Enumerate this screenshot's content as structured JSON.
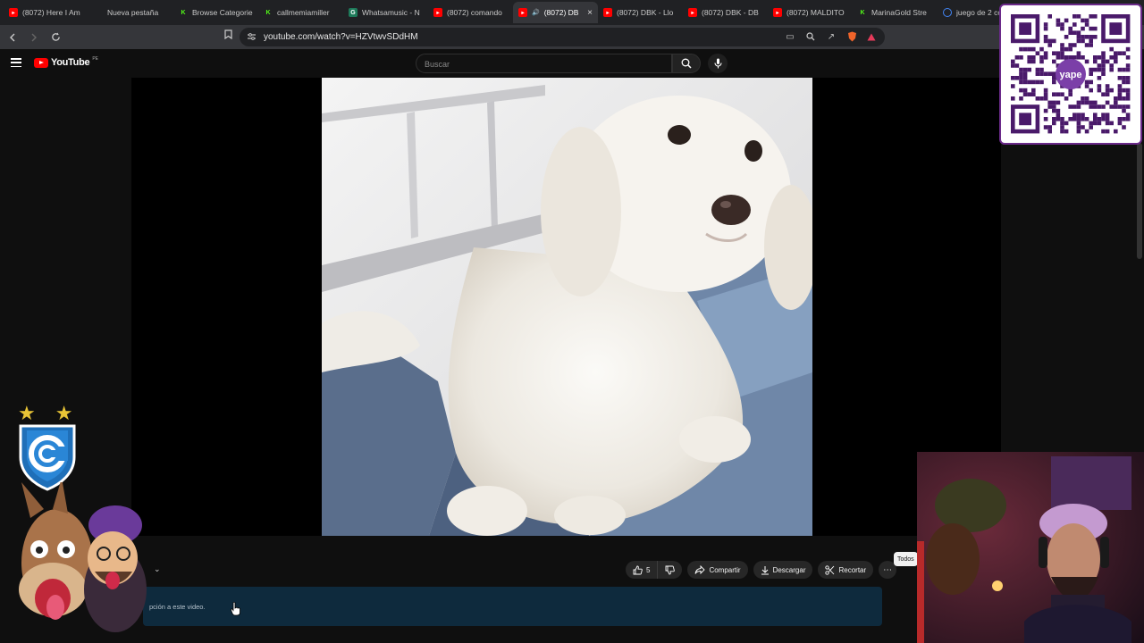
{
  "browser": {
    "tabs": [
      {
        "label": "(8072) Here I Am",
        "icon": "youtube-icon",
        "color": "#ff0000",
        "active": false
      },
      {
        "label": "Nueva pestaña",
        "icon": "",
        "color": "",
        "active": false
      },
      {
        "label": "Browse Categorie",
        "icon": "kick-icon",
        "color": "#53fc18",
        "active": false
      },
      {
        "label": "callmemiamiller",
        "icon": "kick-icon",
        "color": "#53fc18",
        "active": false
      },
      {
        "label": "Whatsamusic - N",
        "icon": "chatgpt-icon",
        "color": "#ffffff",
        "active": false
      },
      {
        "label": "(8072) comando",
        "icon": "youtube-icon",
        "color": "#ff0000",
        "active": false
      },
      {
        "label": "(8072) DB",
        "icon": "youtube-icon",
        "color": "#ff0000",
        "active": true
      },
      {
        "label": "(8072) DBK - Llo",
        "icon": "youtube-icon",
        "color": "#ff0000",
        "active": false
      },
      {
        "label": "(8072) DBK - DB",
        "icon": "youtube-icon",
        "color": "#ff0000",
        "active": false
      },
      {
        "label": "(8072) MALDITO",
        "icon": "youtube-icon",
        "color": "#ff0000",
        "active": false
      },
      {
        "label": "MarinaGold Stre",
        "icon": "kick-icon",
        "color": "#53fc18",
        "active": false
      },
      {
        "label": "juego de 2 co",
        "icon": "google-icon",
        "color": "#4285f4",
        "active": false
      }
    ],
    "url": "youtube.com/watch?v=HZVtwvSDdHM"
  },
  "youtube": {
    "logo_text": "YouTube",
    "country_code": "PE",
    "search_placeholder": "Buscar"
  },
  "video_actions": {
    "likes": "5",
    "share_label": "Compartir",
    "download_label": "Descargar",
    "clip_label": "Recortar"
  },
  "description_snippet": "pción a este video.",
  "chip_all": "Todos",
  "colors": {
    "youtube_red": "#ff0000",
    "kick_green": "#53fc18",
    "qr_purple": "#6b2a8a",
    "desc_bg": "#0e2a3d"
  },
  "qr_logo_text": "yape"
}
